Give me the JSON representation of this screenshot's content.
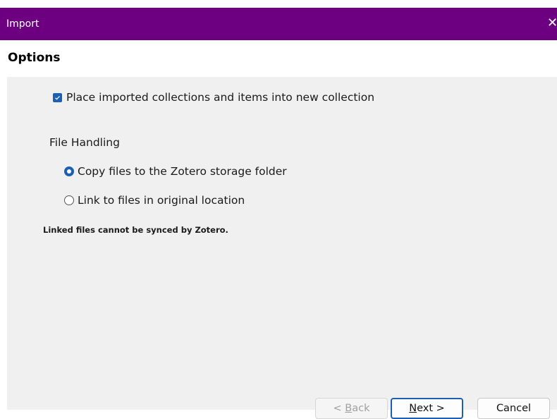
{
  "window": {
    "title": "Import",
    "close_symbol": "✕"
  },
  "page": {
    "heading": "Options"
  },
  "options": {
    "checkbox": {
      "label": "Place imported collections and items into new collection",
      "checked": true
    },
    "file_handling": {
      "label": "File Handling",
      "radios": [
        {
          "label": "Copy files to the Zotero storage folder",
          "selected": true
        },
        {
          "label": "Link to files in original location",
          "selected": false
        }
      ],
      "note": "Linked files cannot be synced by Zotero."
    }
  },
  "buttons": {
    "back": {
      "prefix": "< ",
      "mnemonic": "B",
      "rest": "ack",
      "enabled": false
    },
    "next": {
      "mnemonic": "N",
      "rest": "ext >",
      "enabled": true
    },
    "cancel": "Cancel"
  },
  "colors": {
    "titlebar": "#6c0080",
    "accent": "#1d5fb5",
    "content_bg": "#f0f0f0"
  },
  "icons": {
    "close": "close-icon",
    "checkmark": "checkmark-icon"
  }
}
